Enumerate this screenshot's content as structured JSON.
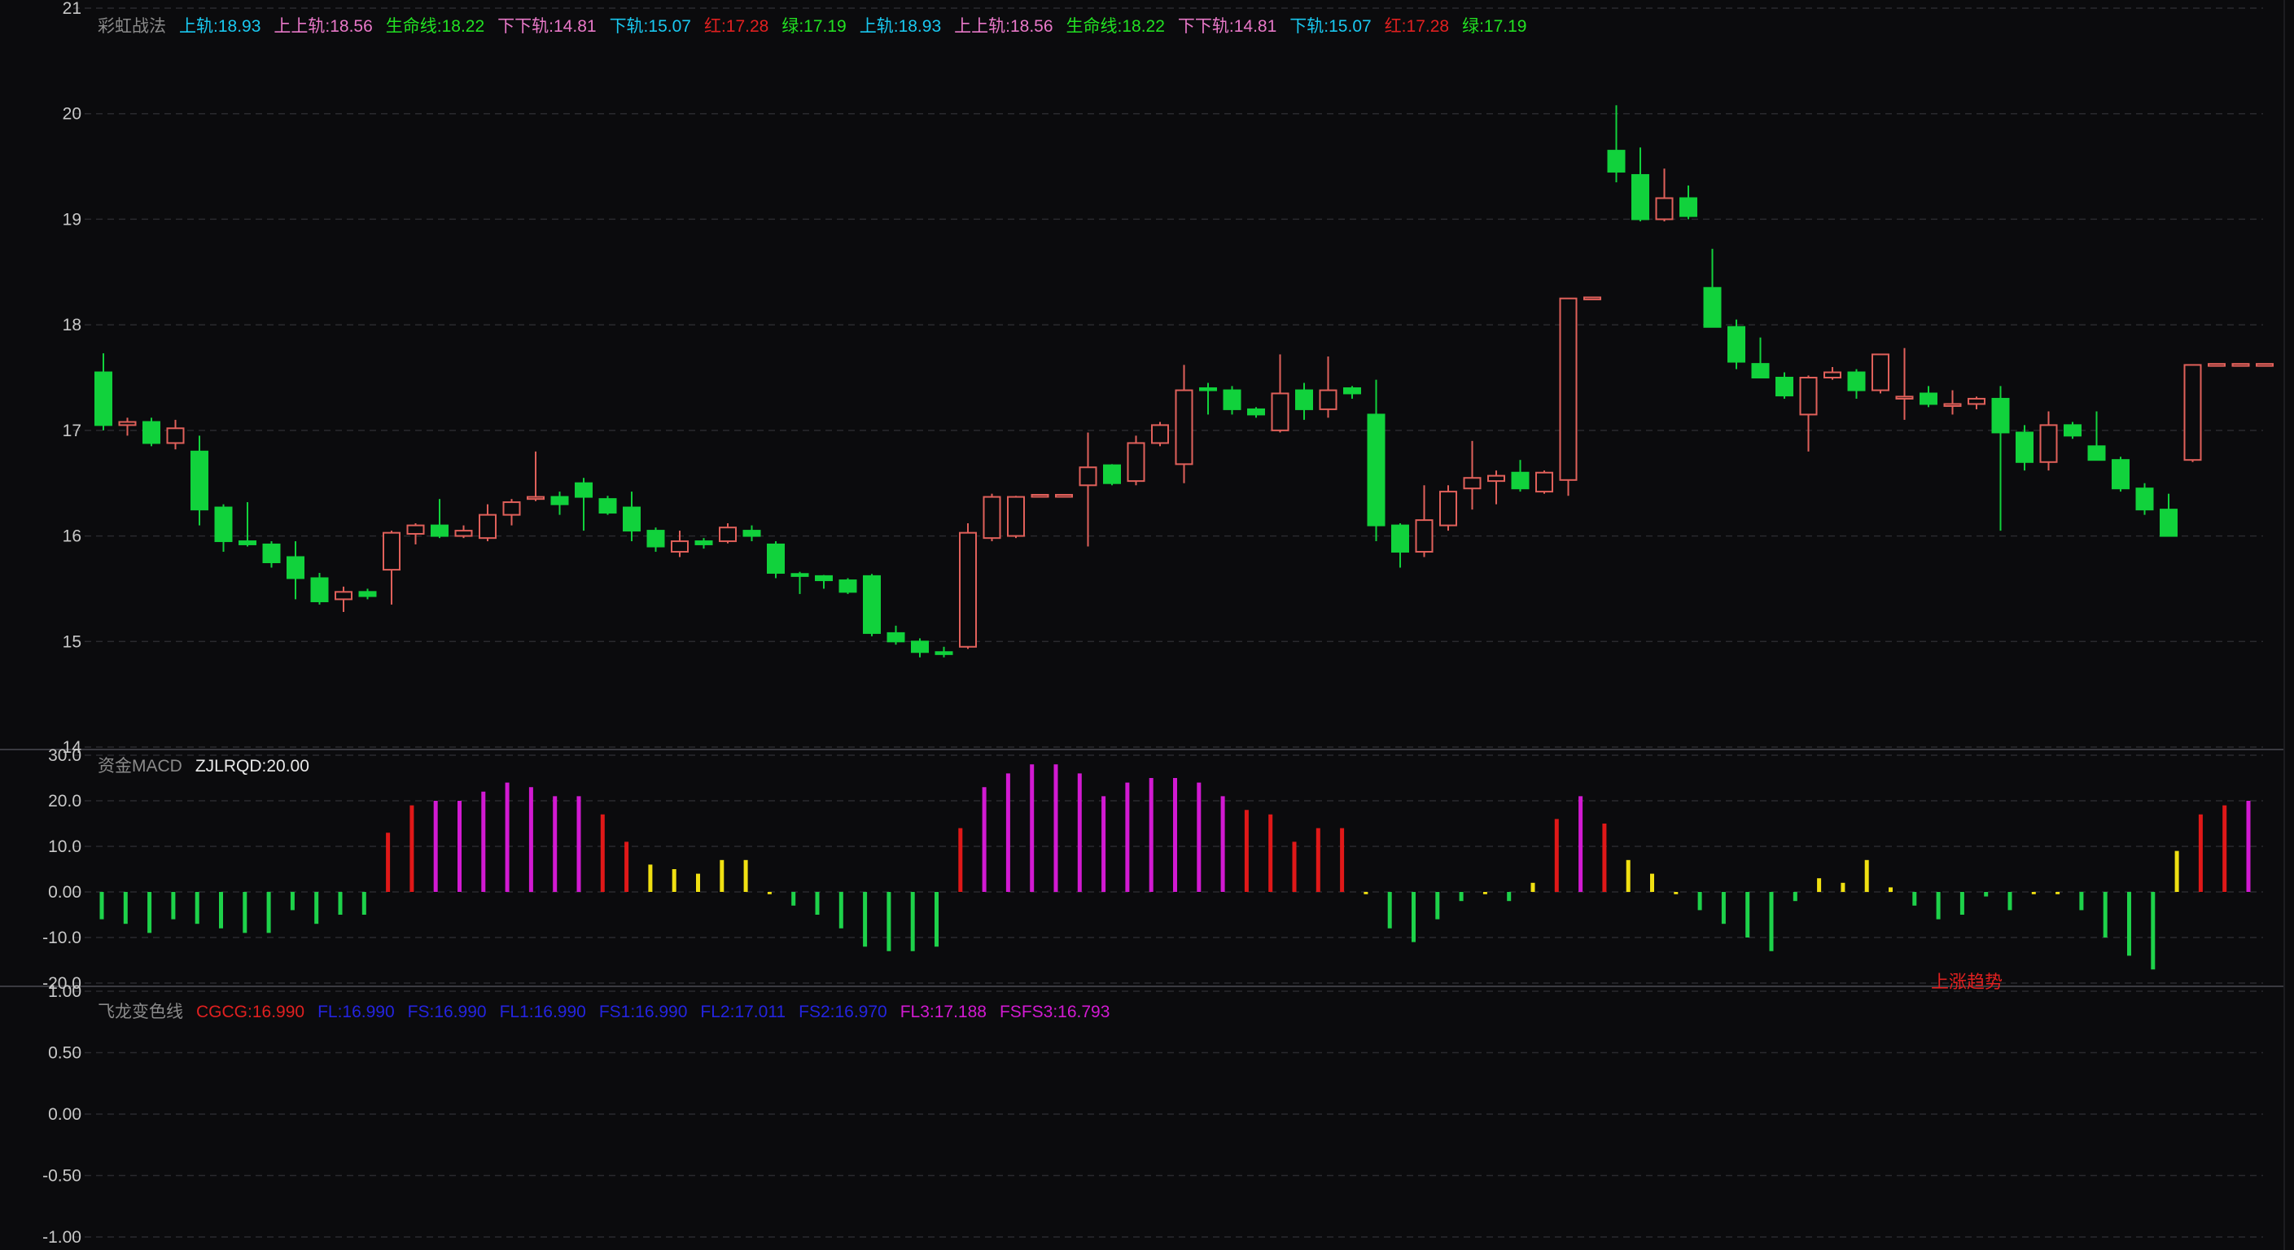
{
  "colors": {
    "up": "#e0605a",
    "down": "#11d23c",
    "grid": "#2a2a2e",
    "axis_text": "#c8c8c8",
    "bar_green": "#1ed24a",
    "bar_red": "#e01818",
    "bar_magenta": "#d21ad2",
    "bar_yellow": "#f0e012"
  },
  "panel1": {
    "legend": [
      {
        "text": "彩虹战法",
        "color": "#8a8a8a"
      },
      {
        "text": "上轨:18.93",
        "color": "#19c8f0"
      },
      {
        "text": "上上轨:18.56",
        "color": "#e878c8"
      },
      {
        "text": "生命线:18.22",
        "color": "#22e022"
      },
      {
        "text": "下下轨:14.81",
        "color": "#e878c8"
      },
      {
        "text": "下轨:15.07",
        "color": "#19c8f0"
      },
      {
        "text": "红:17.28",
        "color": "#e02020"
      },
      {
        "text": "绿:17.19",
        "color": "#22e022"
      },
      {
        "text": "上轨:18.93",
        "color": "#19c8f0"
      },
      {
        "text": "上上轨:18.56",
        "color": "#e878c8"
      },
      {
        "text": "生命线:18.22",
        "color": "#22e022"
      },
      {
        "text": "下下轨:14.81",
        "color": "#e878c8"
      },
      {
        "text": "下轨:15.07",
        "color": "#19c8f0"
      },
      {
        "text": "红:17.28",
        "color": "#e02020"
      },
      {
        "text": "绿:17.19",
        "color": "#22e022"
      }
    ]
  },
  "panel2": {
    "legend": [
      {
        "text": "资金MACD",
        "color": "#8a8a8a"
      },
      {
        "text": "ZJLRQD:20.00",
        "color": "#e8e8e8"
      }
    ],
    "annotation": "上涨趋势"
  },
  "panel3": {
    "legend": [
      {
        "text": "飞龙变色线",
        "color": "#8a8a8a"
      },
      {
        "text": "CGCG:16.990",
        "color": "#e02020"
      },
      {
        "text": "FL:16.990",
        "color": "#2424e0"
      },
      {
        "text": "FS:16.990",
        "color": "#2424e0"
      },
      {
        "text": "FL1:16.990",
        "color": "#2424e0"
      },
      {
        "text": "FS1:16.990",
        "color": "#2424e0"
      },
      {
        "text": "FL2:17.011",
        "color": "#2424e0"
      },
      {
        "text": "FS2:16.970",
        "color": "#2424e0"
      },
      {
        "text": "FL3:17.188",
        "color": "#d21ad2"
      },
      {
        "text": "FSFS3:16.793",
        "color": "#d21ad2"
      }
    ]
  },
  "chart_data": [
    {
      "type": "candlestick",
      "ylim": [
        14,
        21
      ],
      "yticks": [
        "21",
        "20",
        "19",
        "18",
        "17",
        "16",
        "15",
        "14"
      ],
      "ytick_values": [
        21,
        20,
        19,
        18,
        17,
        16,
        15,
        14
      ],
      "candles": [
        {
          "o": 17.55,
          "h": 17.73,
          "l": 17.0,
          "c": 17.05
        },
        {
          "o": 17.05,
          "h": 17.12,
          "l": 16.95,
          "c": 17.08
        },
        {
          "o": 17.08,
          "h": 17.12,
          "l": 16.85,
          "c": 16.88
        },
        {
          "o": 16.88,
          "h": 17.1,
          "l": 16.82,
          "c": 17.02
        },
        {
          "o": 16.8,
          "h": 16.95,
          "l": 16.1,
          "c": 16.25
        },
        {
          "o": 16.27,
          "h": 16.3,
          "l": 15.85,
          "c": 15.95
        },
        {
          "o": 15.95,
          "h": 16.32,
          "l": 15.9,
          "c": 15.92
        },
        {
          "o": 15.92,
          "h": 15.95,
          "l": 15.7,
          "c": 15.75
        },
        {
          "o": 15.8,
          "h": 15.95,
          "l": 15.4,
          "c": 15.6
        },
        {
          "o": 15.6,
          "h": 15.65,
          "l": 15.35,
          "c": 15.38
        },
        {
          "o": 15.4,
          "h": 15.52,
          "l": 15.28,
          "c": 15.47
        },
        {
          "o": 15.47,
          "h": 15.5,
          "l": 15.4,
          "c": 15.43
        },
        {
          "o": 15.68,
          "h": 16.05,
          "l": 15.35,
          "c": 16.03
        },
        {
          "o": 16.02,
          "h": 16.12,
          "l": 15.92,
          "c": 16.1
        },
        {
          "o": 16.1,
          "h": 16.35,
          "l": 15.98,
          "c": 16.0
        },
        {
          "o": 16.0,
          "h": 16.1,
          "l": 15.98,
          "c": 16.05
        },
        {
          "o": 15.98,
          "h": 16.3,
          "l": 15.95,
          "c": 16.2
        },
        {
          "o": 16.2,
          "h": 16.35,
          "l": 16.1,
          "c": 16.32
        },
        {
          "o": 16.35,
          "h": 16.8,
          "l": 16.33,
          "c": 16.37
        },
        {
          "o": 16.37,
          "h": 16.42,
          "l": 16.2,
          "c": 16.3
        },
        {
          "o": 16.5,
          "h": 16.55,
          "l": 16.05,
          "c": 16.37
        },
        {
          "o": 16.35,
          "h": 16.38,
          "l": 16.2,
          "c": 16.22
        },
        {
          "o": 16.27,
          "h": 16.42,
          "l": 15.95,
          "c": 16.05
        },
        {
          "o": 16.05,
          "h": 16.08,
          "l": 15.85,
          "c": 15.9
        },
        {
          "o": 15.85,
          "h": 16.05,
          "l": 15.8,
          "c": 15.95
        },
        {
          "o": 15.95,
          "h": 15.98,
          "l": 15.88,
          "c": 15.92
        },
        {
          "o": 15.95,
          "h": 16.12,
          "l": 15.93,
          "c": 16.08
        },
        {
          "o": 16.05,
          "h": 16.1,
          "l": 15.95,
          "c": 16.0
        },
        {
          "o": 15.92,
          "h": 15.95,
          "l": 15.6,
          "c": 15.65
        },
        {
          "o": 15.64,
          "h": 15.66,
          "l": 15.45,
          "c": 15.62
        },
        {
          "o": 15.62,
          "h": 15.63,
          "l": 15.5,
          "c": 15.58
        },
        {
          "o": 15.58,
          "h": 15.6,
          "l": 15.45,
          "c": 15.47
        },
        {
          "o": 15.62,
          "h": 15.64,
          "l": 15.05,
          "c": 15.08
        },
        {
          "o": 15.08,
          "h": 15.15,
          "l": 14.97,
          "c": 15.0
        },
        {
          "o": 15.0,
          "h": 15.03,
          "l": 14.85,
          "c": 14.9
        },
        {
          "o": 14.9,
          "h": 14.95,
          "l": 14.85,
          "c": 14.88
        },
        {
          "o": 14.95,
          "h": 16.12,
          "l": 14.93,
          "c": 16.03
        },
        {
          "o": 15.98,
          "h": 16.4,
          "l": 15.95,
          "c": 16.37
        },
        {
          "o": 16.0,
          "h": 16.38,
          "l": 15.98,
          "c": 16.37
        },
        {
          "o": 16.38,
          "h": 16.39,
          "l": 16.37,
          "c": 16.39
        },
        {
          "o": 16.38,
          "h": 16.39,
          "l": 16.37,
          "c": 16.39
        },
        {
          "o": 16.48,
          "h": 16.98,
          "l": 15.9,
          "c": 16.65
        },
        {
          "o": 16.67,
          "h": 16.68,
          "l": 16.48,
          "c": 16.5
        },
        {
          "o": 16.52,
          "h": 16.95,
          "l": 16.48,
          "c": 16.88
        },
        {
          "o": 16.88,
          "h": 17.08,
          "l": 16.85,
          "c": 17.05
        },
        {
          "o": 16.68,
          "h": 17.62,
          "l": 16.5,
          "c": 17.38
        },
        {
          "o": 17.4,
          "h": 17.45,
          "l": 17.15,
          "c": 17.38
        },
        {
          "o": 17.38,
          "h": 17.42,
          "l": 17.15,
          "c": 17.2
        },
        {
          "o": 17.2,
          "h": 17.22,
          "l": 17.12,
          "c": 17.15
        },
        {
          "o": 17.0,
          "h": 17.72,
          "l": 16.98,
          "c": 17.35
        },
        {
          "o": 17.38,
          "h": 17.45,
          "l": 17.1,
          "c": 17.2
        },
        {
          "o": 17.2,
          "h": 17.7,
          "l": 17.12,
          "c": 17.38
        },
        {
          "o": 17.4,
          "h": 17.42,
          "l": 17.3,
          "c": 17.35
        },
        {
          "o": 17.15,
          "h": 17.48,
          "l": 15.95,
          "c": 16.1
        },
        {
          "o": 16.1,
          "h": 16.12,
          "l": 15.7,
          "c": 15.85
        },
        {
          "o": 15.85,
          "h": 16.48,
          "l": 15.8,
          "c": 16.15
        },
        {
          "o": 16.1,
          "h": 16.48,
          "l": 16.05,
          "c": 16.42
        },
        {
          "o": 16.45,
          "h": 16.9,
          "l": 16.25,
          "c": 16.55
        },
        {
          "o": 16.52,
          "h": 16.62,
          "l": 16.3,
          "c": 16.57
        },
        {
          "o": 16.6,
          "h": 16.72,
          "l": 16.42,
          "c": 16.45
        },
        {
          "o": 16.42,
          "h": 16.62,
          "l": 16.4,
          "c": 16.6
        },
        {
          "o": 16.53,
          "h": 18.25,
          "l": 16.38,
          "c": 18.25
        },
        {
          "o": 18.25,
          "h": 18.26,
          "l": 18.24,
          "c": 18.26
        },
        {
          "o": 19.65,
          "h": 20.08,
          "l": 19.35,
          "c": 19.45
        },
        {
          "o": 19.42,
          "h": 19.68,
          "l": 18.98,
          "c": 19.0
        },
        {
          "o": 19.0,
          "h": 19.48,
          "l": 18.98,
          "c": 19.2
        },
        {
          "o": 19.2,
          "h": 19.32,
          "l": 19.0,
          "c": 19.03
        },
        {
          "o": 18.35,
          "h": 18.72,
          "l": 18.0,
          "c": 17.98
        },
        {
          "o": 17.98,
          "h": 18.05,
          "l": 17.58,
          "c": 17.65
        },
        {
          "o": 17.63,
          "h": 17.88,
          "l": 17.5,
          "c": 17.5
        },
        {
          "o": 17.5,
          "h": 17.55,
          "l": 17.3,
          "c": 17.33
        },
        {
          "o": 17.15,
          "h": 17.52,
          "l": 16.8,
          "c": 17.5
        },
        {
          "o": 17.5,
          "h": 17.6,
          "l": 17.48,
          "c": 17.55
        },
        {
          "o": 17.55,
          "h": 17.58,
          "l": 17.3,
          "c": 17.38
        },
        {
          "o": 17.38,
          "h": 17.72,
          "l": 17.35,
          "c": 17.72
        },
        {
          "o": 17.3,
          "h": 17.78,
          "l": 17.1,
          "c": 17.32
        },
        {
          "o": 17.35,
          "h": 17.42,
          "l": 17.22,
          "c": 17.25
        },
        {
          "o": 17.25,
          "h": 17.38,
          "l": 17.15,
          "c": 17.25
        },
        {
          "o": 17.25,
          "h": 17.32,
          "l": 17.2,
          "c": 17.3
        },
        {
          "o": 17.3,
          "h": 17.42,
          "l": 16.05,
          "c": 16.98
        },
        {
          "o": 16.98,
          "h": 17.05,
          "l": 16.62,
          "c": 16.7
        },
        {
          "o": 16.7,
          "h": 17.18,
          "l": 16.62,
          "c": 17.05
        },
        {
          "o": 17.05,
          "h": 17.08,
          "l": 16.92,
          "c": 16.95
        },
        {
          "o": 16.85,
          "h": 17.18,
          "l": 16.72,
          "c": 16.72
        },
        {
          "o": 16.72,
          "h": 16.75,
          "l": 16.42,
          "c": 16.45
        },
        {
          "o": 16.45,
          "h": 16.5,
          "l": 16.2,
          "c": 16.25
        },
        {
          "o": 16.25,
          "h": 16.4,
          "l": 16.0,
          "c": 16.0
        },
        {
          "o": 16.72,
          "h": 17.62,
          "l": 16.7,
          "c": 17.62
        },
        {
          "o": 17.62,
          "h": 17.63,
          "l": 17.61,
          "c": 17.63
        },
        {
          "o": 17.62,
          "h": 17.63,
          "l": 17.61,
          "c": 17.63
        },
        {
          "o": 17.62,
          "h": 17.63,
          "l": 17.61,
          "c": 17.63
        }
      ]
    },
    {
      "type": "bar",
      "ylim": [
        -20,
        30
      ],
      "yticks": [
        "30.0",
        "20.0",
        "10.0",
        "0.00",
        "-10.0",
        "-20.0"
      ],
      "ytick_values": [
        30,
        20,
        10,
        0,
        -10,
        -20
      ],
      "values": [
        -6,
        -7,
        -9,
        -6,
        -7,
        -8,
        -9,
        -9,
        -4,
        -7,
        -5,
        -5,
        13,
        19,
        20,
        20,
        22,
        24,
        23,
        21,
        21,
        17,
        11,
        6,
        5,
        4,
        7,
        7,
        -0.5,
        -3,
        -5,
        -8,
        -12,
        -13,
        -13,
        -12,
        14,
        23,
        26,
        28,
        28,
        26,
        21,
        24,
        25,
        25,
        24,
        21,
        18,
        17,
        11,
        14,
        14,
        -0.5,
        -8,
        -11,
        -6,
        -2,
        -0.5,
        -2,
        2,
        16,
        21,
        15,
        7,
        4,
        -0.5,
        -4,
        -7,
        -10,
        -13,
        -2,
        3,
        2,
        7,
        1,
        -3,
        -6,
        -5,
        -1,
        -4,
        -0.5,
        -0.5,
        -4,
        -10,
        -14,
        -17,
        9,
        17,
        19,
        20
      ],
      "colors": [
        "g",
        "g",
        "g",
        "g",
        "g",
        "g",
        "g",
        "g",
        "g",
        "g",
        "g",
        "g",
        "r",
        "r",
        "m",
        "m",
        "m",
        "m",
        "m",
        "m",
        "m",
        "r",
        "r",
        "y",
        "y",
        "y",
        "y",
        "y",
        "y",
        "g",
        "g",
        "g",
        "g",
        "g",
        "g",
        "g",
        "r",
        "m",
        "m",
        "m",
        "m",
        "m",
        "m",
        "m",
        "m",
        "m",
        "m",
        "m",
        "r",
        "r",
        "r",
        "r",
        "r",
        "y",
        "g",
        "g",
        "g",
        "g",
        "y",
        "g",
        "y",
        "r",
        "m",
        "r",
        "y",
        "y",
        "y",
        "g",
        "g",
        "g",
        "g",
        "g",
        "y",
        "y",
        "y",
        "y",
        "g",
        "g",
        "g",
        "g",
        "g",
        "y",
        "y",
        "g",
        "g",
        "g",
        "g",
        "y",
        "r",
        "r",
        "m"
      ]
    },
    {
      "type": "line",
      "ylim": [
        -1,
        1
      ],
      "yticks": [
        "1.00",
        "0.50",
        "0.00",
        "-0.50",
        "-1.00"
      ],
      "ytick_values": [
        1,
        0.5,
        0,
        -0.5,
        -1
      ],
      "values": []
    }
  ]
}
